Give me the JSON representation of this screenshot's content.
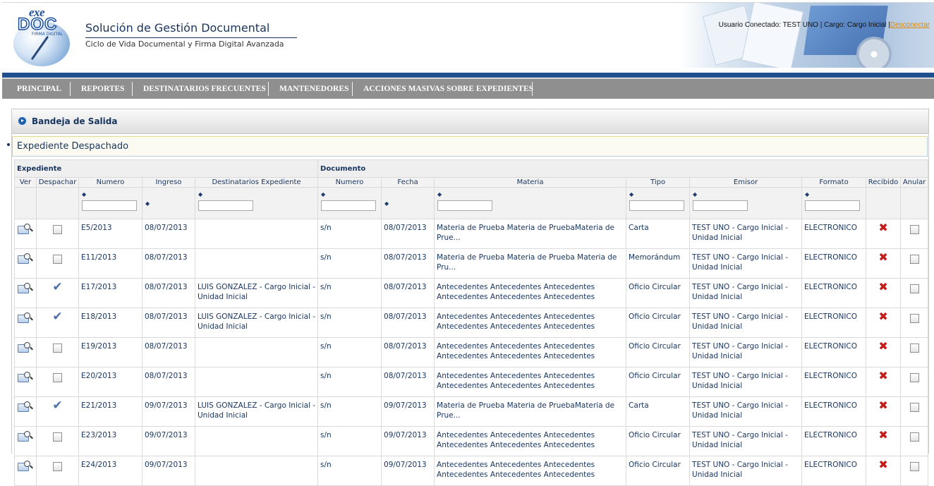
{
  "header": {
    "logo_exe": "exe",
    "logo_doc": "DOC",
    "logo_firma": "FIRMA DIGITAL",
    "title": "Solución de Gestión Documental",
    "subtitle": "Ciclo de Vida Documental y Firma Digital Avanzada",
    "user_info": "Usuario Conectado: TEST UNO | Cargo: Cargo Inicial |",
    "logout_label": "Desconectar"
  },
  "menu": {
    "items": [
      {
        "label": "PRINCIPAL"
      },
      {
        "label": "REPORTES"
      },
      {
        "label": "DESTINATARIOS FRECUENTES"
      },
      {
        "label": "MANTENEDORES"
      },
      {
        "label": "ACCIONES MASIVAS SOBRE EXPEDIENTES"
      }
    ]
  },
  "panel": {
    "title": "Bandeja de Salida",
    "notice": "Expediente Despachado"
  },
  "table": {
    "group_expediente": "Expediente",
    "group_documento": "Documento",
    "columns": [
      "Ver",
      "Despachar",
      "Numero",
      "Ingreso",
      "Destinatarios Expediente",
      "Numero",
      "Fecha",
      "Materia",
      "Tipo",
      "Emisor",
      "Formato",
      "Recibido",
      "Anular"
    ],
    "sort_icon": "sort-icon",
    "rows": [
      {
        "numero": "E5/2013",
        "ingreso": "08/07/2013",
        "destinatarios": "",
        "doc_numero": "s/n",
        "fecha": "08/07/2013",
        "materia": "Materia de Prueba Materia de PruebaMateria de Prue...",
        "tipo": "Carta",
        "emisor": "TEST UNO - Cargo Inicial - Unidad Inicial",
        "formato": "ELECTRONICO",
        "despachado": false
      },
      {
        "numero": "E11/2013",
        "ingreso": "08/07/2013",
        "destinatarios": "",
        "doc_numero": "s/n",
        "fecha": "08/07/2013",
        "materia": "Materia de Prueba Materia de Prueba Materia de Pru...",
        "tipo": "Memorándum",
        "emisor": "TEST UNO - Cargo Inicial - Unidad Inicial",
        "formato": "ELECTRONICO",
        "despachado": false
      },
      {
        "numero": "E17/2013",
        "ingreso": "08/07/2013",
        "destinatarios": "LUIS GONZALEZ - Cargo Inicial - Unidad Inicial",
        "doc_numero": "s/n",
        "fecha": "08/07/2013",
        "materia": "Antecedentes Antecedentes Antecedentes Antecedentes Antecedentes Antecedentes",
        "tipo": "Oficio Circular",
        "emisor": "TEST UNO - Cargo Inicial - Unidad Inicial",
        "formato": "ELECTRONICO",
        "despachado": true
      },
      {
        "numero": "E18/2013",
        "ingreso": "08/07/2013",
        "destinatarios": "LUIS GONZALEZ - Cargo Inicial - Unidad Inicial",
        "doc_numero": "s/n",
        "fecha": "08/07/2013",
        "materia": "Antecedentes Antecedentes Antecedentes Antecedentes Antecedentes Antecedentes",
        "tipo": "Oficio Circular",
        "emisor": "TEST UNO - Cargo Inicial - Unidad Inicial",
        "formato": "ELECTRONICO",
        "despachado": true
      },
      {
        "numero": "E19/2013",
        "ingreso": "08/07/2013",
        "destinatarios": "",
        "doc_numero": "s/n",
        "fecha": "08/07/2013",
        "materia": "Antecedentes Antecedentes Antecedentes Antecedentes Antecedentes Antecedentes",
        "tipo": "Oficio Circular",
        "emisor": "TEST UNO - Cargo Inicial - Unidad Inicial",
        "formato": "ELECTRONICO",
        "despachado": false
      },
      {
        "numero": "E20/2013",
        "ingreso": "08/07/2013",
        "destinatarios": "",
        "doc_numero": "s/n",
        "fecha": "08/07/2013",
        "materia": "Antecedentes Antecedentes Antecedentes Antecedentes Antecedentes Antecedentes",
        "tipo": "Oficio Circular",
        "emisor": "TEST UNO - Cargo Inicial - Unidad Inicial",
        "formato": "ELECTRONICO",
        "despachado": false
      },
      {
        "numero": "E21/2013",
        "ingreso": "09/07/2013",
        "destinatarios": "LUIS GONZALEZ - Cargo Inicial - Unidad Inicial",
        "doc_numero": "s/n",
        "fecha": "09/07/2013",
        "materia": "Materia de Prueba Materia de PruebaMateria de Prue...",
        "tipo": "Carta",
        "emisor": "TEST UNO - Cargo Inicial - Unidad Inicial",
        "formato": "ELECTRONICO",
        "despachado": true
      },
      {
        "numero": "E23/2013",
        "ingreso": "09/07/2013",
        "destinatarios": "",
        "doc_numero": "s/n",
        "fecha": "09/07/2013",
        "materia": "Antecedentes Antecedentes Antecedentes Antecedentes Antecedentes Antecedentes",
        "tipo": "Oficio Circular",
        "emisor": "TEST UNO - Cargo Inicial - Unidad Inicial",
        "formato": "ELECTRONICO",
        "despachado": false
      },
      {
        "numero": "E24/2013",
        "ingreso": "09/07/2013",
        "destinatarios": "",
        "doc_numero": "s/n",
        "fecha": "09/07/2013",
        "materia": "Antecedentes Antecedentes Antecedentes Antecedentes Antecedentes Antecedentes",
        "tipo": "Oficio Circular",
        "emisor": "TEST UNO - Cargo Inicial - Unidad Inicial",
        "formato": "ELECTRONICO",
        "despachado": false
      }
    ]
  },
  "icons": {
    "ver": "folder-magnifier-icon",
    "despachado": "checkmark-icon",
    "recibido": "red-x-icon"
  },
  "colors": {
    "brand_blue": "#1f4f8e",
    "menu_gray": "#8f8f8f",
    "text_navy": "#17345f",
    "logout_orange": "#e08a00",
    "recibido_red": "#c41a1a"
  }
}
